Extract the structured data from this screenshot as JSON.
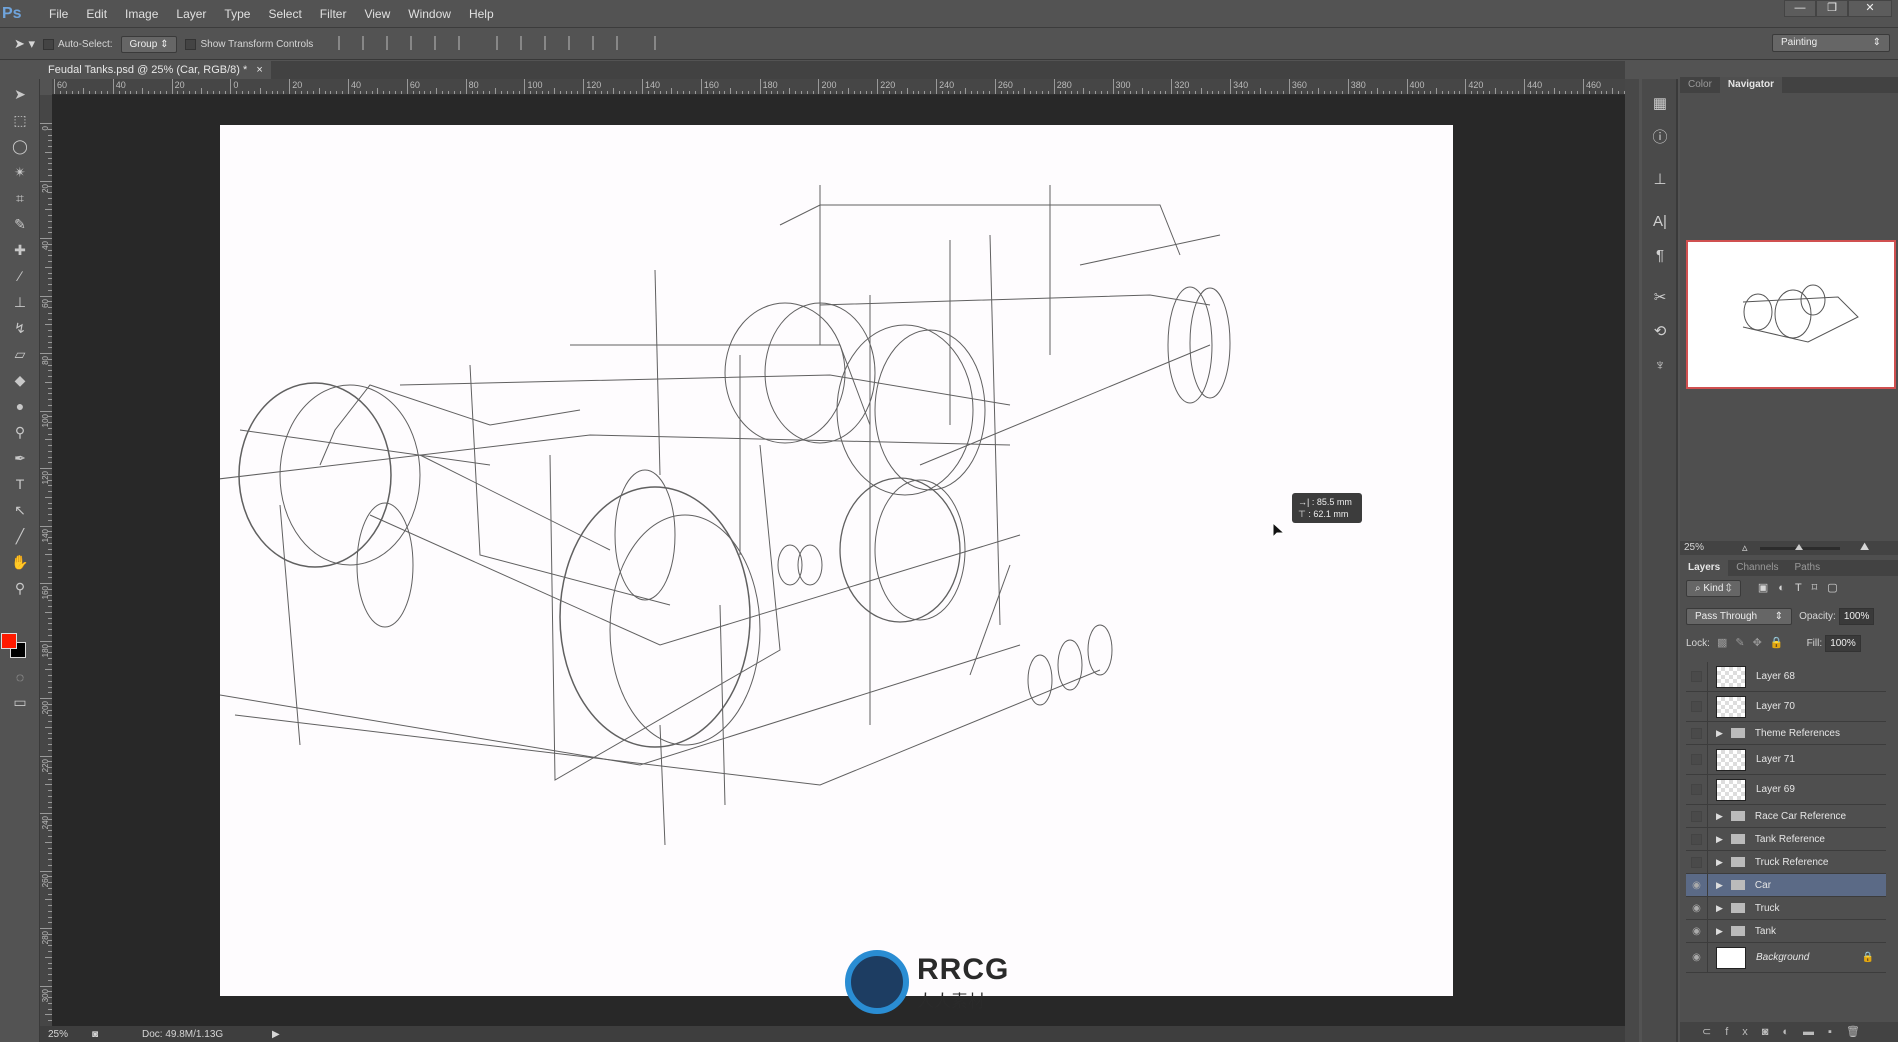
{
  "app": {
    "logo": "Ps",
    "menu": [
      "File",
      "Edit",
      "Image",
      "Layer",
      "Type",
      "Select",
      "Filter",
      "View",
      "Window",
      "Help"
    ],
    "window_controls": [
      "minimize",
      "restore",
      "close"
    ]
  },
  "options": {
    "auto_select_label": "Auto-Select:",
    "auto_select_value": "Group",
    "show_transform_label": "Show Transform Controls",
    "workspace": "Painting"
  },
  "document": {
    "tab_title": "Feudal Tanks.psd @ 25% (Car, RGB/8) *",
    "close": "×"
  },
  "rulers": {
    "horizontal": [
      "60",
      "40",
      "20",
      "0",
      "20",
      "40",
      "60",
      "80",
      "100",
      "120",
      "140",
      "160",
      "180",
      "200",
      "220",
      "240",
      "260",
      "280",
      "300",
      "320",
      "340",
      "360",
      "380",
      "400",
      "420",
      "440",
      "460"
    ],
    "vertical": [
      "0",
      "20",
      "40",
      "60",
      "80",
      "100",
      "120",
      "140",
      "160",
      "180",
      "200",
      "220",
      "240",
      "260",
      "280",
      "300"
    ]
  },
  "tooltip": {
    "width": "85.5 mm",
    "height": "62.1 mm"
  },
  "status": {
    "zoom": "25%",
    "doc": "Doc: 49.8M/1.13G"
  },
  "colors": {
    "foreground": "#ff1a00",
    "background": "#000000",
    "selected_layer": "#5b6a86",
    "nav_frame": "#d05050"
  },
  "navigator": {
    "tabs": [
      "Color",
      "Navigator"
    ],
    "active": "Navigator",
    "zoom": "25%"
  },
  "layers": {
    "tabs": [
      "Layers",
      "Channels",
      "Paths"
    ],
    "filter": "Kind",
    "blend_mode": "Pass Through",
    "opacity_label": "Opacity:",
    "opacity": "100%",
    "lock_label": "Lock:",
    "fill_label": "Fill:",
    "fill": "100%",
    "items": [
      {
        "name": "Layer 68",
        "type": "layer",
        "visible": false
      },
      {
        "name": "Layer 70",
        "type": "layer",
        "visible": false
      },
      {
        "name": "Theme References",
        "type": "group",
        "visible": false
      },
      {
        "name": "Layer 71",
        "type": "layer",
        "visible": false
      },
      {
        "name": "Layer 69",
        "type": "layer",
        "visible": false
      },
      {
        "name": "Race Car Reference",
        "type": "group",
        "visible": false
      },
      {
        "name": "Tank Reference",
        "type": "group",
        "visible": false
      },
      {
        "name": "Truck Reference",
        "type": "group",
        "visible": false
      },
      {
        "name": "Car",
        "type": "group",
        "visible": true,
        "selected": true
      },
      {
        "name": "Truck",
        "type": "group",
        "visible": true
      },
      {
        "name": "Tank",
        "type": "group",
        "visible": true
      },
      {
        "name": "Background",
        "type": "background",
        "visible": true,
        "locked": true
      }
    ]
  },
  "watermark": {
    "text": "RRCG",
    "subtitle": "人人素材"
  },
  "tools": [
    "move",
    "marquee",
    "lasso",
    "magic-wand",
    "crop",
    "eyedropper",
    "healing",
    "brush",
    "stamp",
    "history-brush",
    "eraser",
    "paint-bucket",
    "blur",
    "dodge",
    "pen",
    "type",
    "path-select",
    "line",
    "hand",
    "zoom"
  ]
}
